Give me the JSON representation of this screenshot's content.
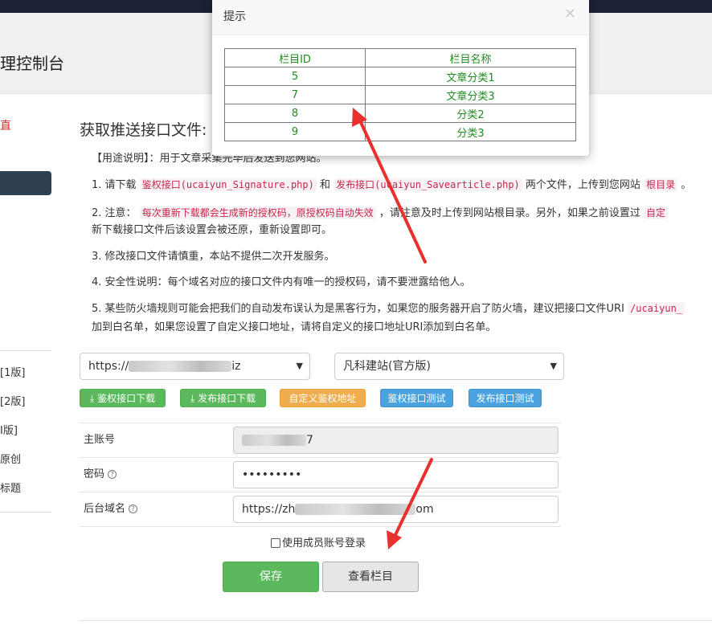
{
  "header": {
    "title": "理控制台"
  },
  "sidebar": {
    "top_link": "直",
    "items": [
      {
        "label": "[1版]"
      },
      {
        "label": "[2版]"
      },
      {
        "label": "I版]"
      },
      {
        "label": "原创"
      },
      {
        "label": "标题"
      }
    ]
  },
  "main": {
    "title": "获取推送接口文件:",
    "p0": "【用途说明】：用于文章采集完毕后发送到您网站。",
    "p1": {
      "a": "1. 请下载",
      "code1": "鉴权接口(ucaiyun_Signature.php)",
      "b": "和",
      "code2": "发布接口(ucaiyun_Savearticle.php)",
      "c": "两个文件，上传到您网站",
      "code3": "根目录",
      "d": "。"
    },
    "p2": {
      "a": "2. 注意：",
      "code1": "每次重新下载都会生成新的授权码，原授权码自动失效",
      "b": "，请注意及时上传到网站根目录。另外，如果之前设置过",
      "code2": "自定",
      "line2": "新下载接口文件后该设置会被还原，重新设置即可。"
    },
    "p3": "3. 修改接口文件请慎重，本站不提供二次开发服务。",
    "p4": "4. 安全性说明：每个域名对应的接口文件内有唯一的授权码，请不要泄露给他人。",
    "p5": {
      "a": "5. 某些防火墙规则可能会把我们的自动发布误认为是黑客行为，如果您的服务器开启了防火墙，建议把接口文件URI",
      "code1": "/ucaiyun_",
      "line2": "加到白名单，如果您设置了自定义接口地址，请将自定义的接口地址URI添加到白名单。"
    }
  },
  "site_select": {
    "prefix": "https://",
    "suffix": "iz"
  },
  "cms_select": {
    "value": "凡科建站(官方版)"
  },
  "buttons": {
    "download_sig": "鉴权接口下载",
    "download_pub": "发布接口下载",
    "custom_auth": "自定义鉴权地址",
    "test_sig": "鉴权接口测试",
    "test_pub": "发布接口测试",
    "save": "保存",
    "view_columns": "查看栏目"
  },
  "form": {
    "account_label": "主账号",
    "account_suffix": "7",
    "password_label": "密码",
    "password_value": "•••••••••",
    "domain_label": "后台域名",
    "domain_prefix": "https://zh",
    "domain_suffix": "om",
    "member_login_label": "使用成员账号登录"
  },
  "modal": {
    "title": "提示",
    "close": "✕",
    "columns": [
      "栏目ID",
      "栏目名称"
    ],
    "rows": [
      {
        "id": "5",
        "name": "文章分类1"
      },
      {
        "id": "7",
        "name": "文章分类3"
      },
      {
        "id": "8",
        "name": "分类2"
      },
      {
        "id": "9",
        "name": "分类3"
      }
    ]
  },
  "colors": {
    "annotation_arrow": "#e8312c",
    "table_text": "#228b22",
    "code_text": "#c7254e",
    "topbar": "#1b2235"
  },
  "icons": {
    "download": "download-icon",
    "help": "question-circle-icon",
    "close": "close-icon",
    "select_chevron": "chevron-down-icon"
  }
}
